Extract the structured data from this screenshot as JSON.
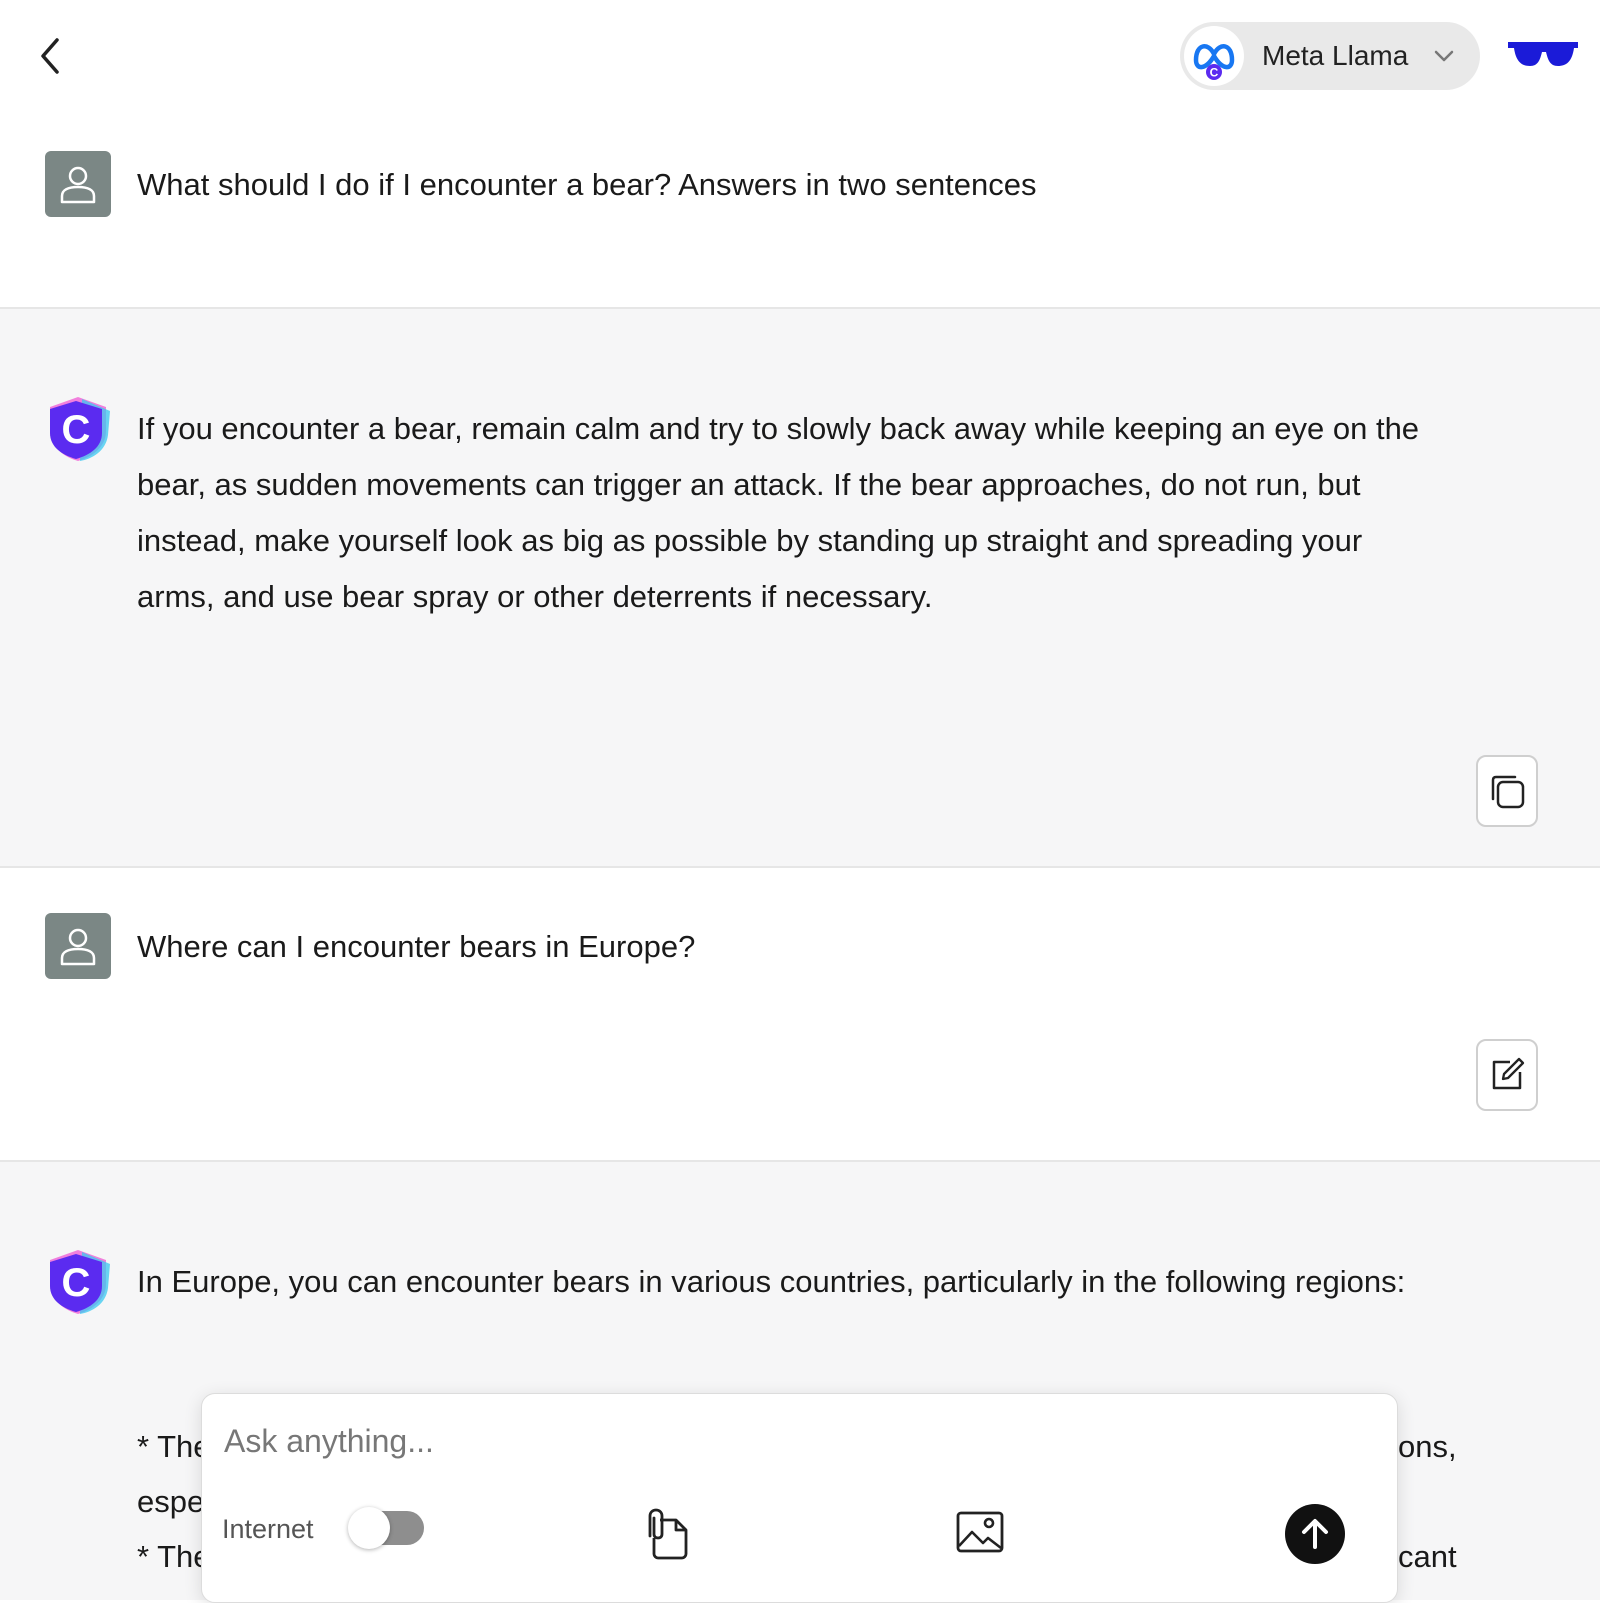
{
  "header": {
    "model_name": "Meta Llama",
    "back_icon": "chevron-left-icon",
    "glasses_color": "#1b1bd8"
  },
  "messages": [
    {
      "role": "user",
      "text": "What should I do if I encounter a bear? Answers in two sentences"
    },
    {
      "role": "assistant",
      "text": "If you encounter a bear, remain calm and try to slowly back away while keeping an eye on the bear, as sudden movements can trigger an attack. If the bear approaches, do not run, but instead, make yourself look as big as possible by standing up straight and spreading your arms, and use bear spray or other deterrents if necessary."
    },
    {
      "role": "user",
      "text": "Where can I encounter bears in Europe?"
    },
    {
      "role": "assistant",
      "text": "In Europe, you can encounter bears in various countries, particularly in the following regions:"
    }
  ],
  "partial": {
    "line1_left": "* The",
    "line1_right": "ons,",
    "line2_left": "espe",
    "line3_left": "* The",
    "line3_right": "cant"
  },
  "composer": {
    "placeholder": "Ask anything...",
    "internet_label": "Internet",
    "internet_enabled": false
  },
  "colors": {
    "accent": "#5b2bf0",
    "user_avatar_bg": "#7b8785",
    "assistant_row_bg": "#f6f6f7"
  }
}
